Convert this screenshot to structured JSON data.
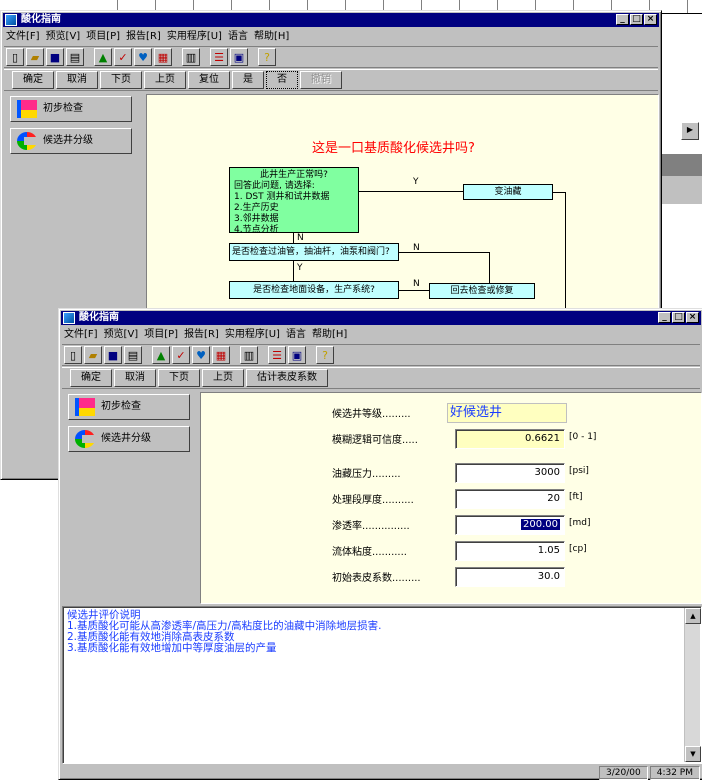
{
  "app_title": "酸化指南",
  "menu": [
    "文件[F]",
    "预览[V]",
    "项目[P]",
    "报告[R]",
    "实用程序[U]",
    "语言",
    "帮助[H]"
  ],
  "nav1": {
    "ok": "确定",
    "cancel": "取消",
    "next": "下页",
    "prev": "上页",
    "reset": "复位",
    "yes": "是",
    "no": "否",
    "undo": "撤销"
  },
  "nav2": {
    "ok": "确定",
    "cancel": "取消",
    "next": "下页",
    "prev": "上页",
    "estimate": "估计表皮系数"
  },
  "sidebar": {
    "item1": "初步检查",
    "item2": "候选井分级"
  },
  "flow": {
    "question": "这是一口基质酸化候选井吗?",
    "box1_lines": [
      "此井生产正常吗?",
      "回答此问题, 请选择:",
      "1. DST 测井和试井数据",
      "2.生产历史",
      "3.邻井数据",
      "4.节点分析"
    ],
    "box_right": "变油藏",
    "box2": "是否检查过油管，抽油杆，油泵和阀门?",
    "box3": "是否检查地面设备，生产系统?",
    "box_repair": "回去检查或修复",
    "y1": "Y",
    "y2": "Y",
    "n1": "N",
    "n2": "N",
    "n3": "N"
  },
  "form": {
    "grade": {
      "label": "候选井等级.........",
      "value": "好候选井"
    },
    "fuzzy": {
      "label": "模糊逻辑可信度.....",
      "value": "0.6621",
      "unit": "[0 - 1]"
    },
    "pressure": {
      "label": "油藏压力.........",
      "value": "3000",
      "unit": "[psi]"
    },
    "thickness": {
      "label": "处理段厚度..........",
      "value": "20",
      "unit": "[ft]"
    },
    "perm": {
      "label": "渗透率...............",
      "value": "200.00",
      "unit": "[md]"
    },
    "viscosity": {
      "label": "流体粘度...........",
      "value": "1.05",
      "unit": "[cp]"
    },
    "skin": {
      "label": "初始表皮系数.........",
      "value": "30.0"
    }
  },
  "notes": {
    "title": "候选井评价说明",
    "lines": [
      "1.基质酸化可能从高渗透率/高压力/高粘度比的油藏中消除地层损害.",
      "2.基质酸化能有效地消除高表皮系数",
      "3.基质酸化能有效地增加中等厚度油层的产量"
    ]
  },
  "status": {
    "date": "3/20/00",
    "time": "4:32 PM"
  },
  "colors": {
    "title_bar": "#000080",
    "accent_red": "#ff0000",
    "flow_green": "#80ffa0",
    "flow_cyan": "#c0ffff",
    "note_blue": "#1a3cff",
    "panel_yellow": "#ffffe6"
  }
}
